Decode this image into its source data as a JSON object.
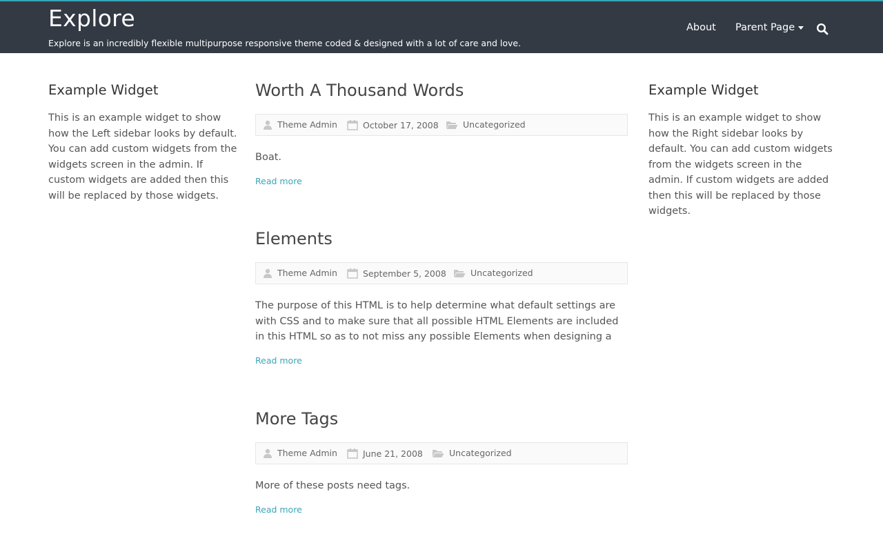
{
  "site": {
    "title": "Explore",
    "description": "Explore is an incredibly flexible multipurpose responsive theme coded & designed with a lot of care and love."
  },
  "nav": {
    "items": [
      {
        "label": "About"
      },
      {
        "label": "Parent Page",
        "has_dropdown": true
      }
    ],
    "search_icon": "search-icon"
  },
  "sidebar_left": {
    "title": "Example Widget",
    "text": "This is an example widget to show how the Left sidebar looks by default. You can add custom widgets from the widgets screen in the admin. If custom widgets are added then this will be replaced by those widgets."
  },
  "sidebar_right": {
    "title": "Example Widget",
    "text": "This is an example widget to show how the Right sidebar looks by default. You can add custom widgets from the widgets screen in the admin. If custom widgets are added then this will be replaced by those widgets."
  },
  "posts": [
    {
      "title": "Worth A Thousand Words",
      "author": "Theme Admin",
      "date": "October 17, 2008",
      "category": "Uncategorized",
      "excerpt": "Boat.",
      "read_more": "Read more"
    },
    {
      "title": "Elements",
      "author": "Theme Admin",
      "date": "September 5, 2008",
      "category": "Uncategorized",
      "excerpt": "The purpose of this HTML is to help determine what default settings are with CSS and to make sure that all possible HTML Elements are included in this HTML so as to not miss any possible Elements when designing a",
      "read_more": "Read more"
    },
    {
      "title": "More Tags",
      "author": "Theme Admin",
      "date": "June 21, 2008",
      "category": "Uncategorized",
      "excerpt": "More of these posts need tags.",
      "read_more": "Read more"
    }
  ],
  "colors": {
    "header_bg": "#333a44",
    "accent": "#3aa5b8",
    "text": "#555555"
  }
}
